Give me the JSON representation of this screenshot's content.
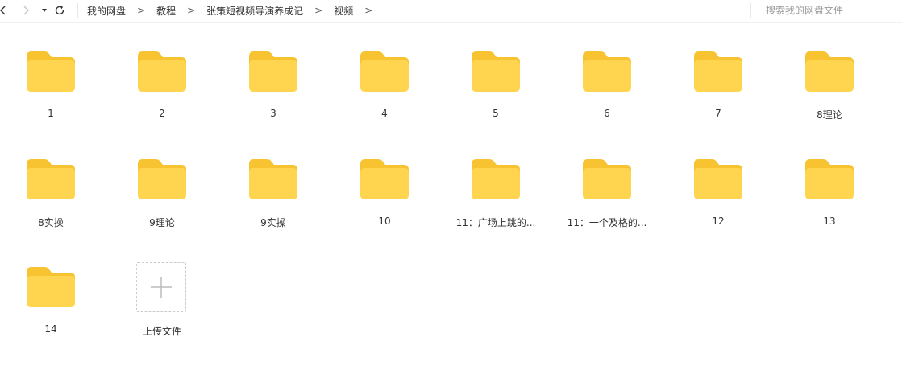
{
  "toolbar": {
    "breadcrumb": [
      "我的网盘",
      "教程",
      "张策短视频导演养成记",
      "视频"
    ],
    "separator": ">",
    "search_placeholder": "搜索我的网盘文件"
  },
  "colors": {
    "folder_back": "#F7C331",
    "folder_front": "#FFD54F",
    "accent_gray": "#BBBBBB"
  },
  "folders": [
    {
      "name": "1"
    },
    {
      "name": "2"
    },
    {
      "name": "3"
    },
    {
      "name": "4"
    },
    {
      "name": "5"
    },
    {
      "name": "6"
    },
    {
      "name": "7"
    },
    {
      "name": "8理论"
    },
    {
      "name": "8实操"
    },
    {
      "name": "9理论"
    },
    {
      "name": "9实操"
    },
    {
      "name": "10"
    },
    {
      "name": "11：广场上跳的..."
    },
    {
      "name": "11：一个及格的..."
    },
    {
      "name": "12"
    },
    {
      "name": "13"
    },
    {
      "name": "14"
    }
  ],
  "upload": {
    "label": "上传文件"
  }
}
